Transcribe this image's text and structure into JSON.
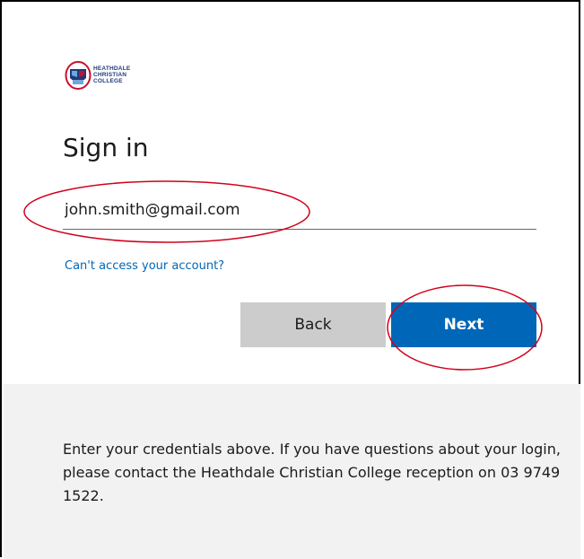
{
  "logo": {
    "text_lines": [
      "HEATHDALE",
      "CHRISTIAN",
      "COLLEGE"
    ]
  },
  "signin": {
    "title": "Sign in",
    "email_value": "john.smith@gmail.com",
    "cant_access_link": "Can't access your account?",
    "back_label": "Back",
    "next_label": "Next"
  },
  "footer": {
    "message": "Enter your credentials above. If you have questions about your login, please contact the Heathdale Christian College reception on 03 9749 1522."
  },
  "colors": {
    "accent": "#0067b8",
    "back_button": "#cccccc",
    "footer_bg": "#f2f2f2",
    "annotation": "#d0021b"
  },
  "icons": {
    "logo_crest": "school-crest-icon"
  }
}
